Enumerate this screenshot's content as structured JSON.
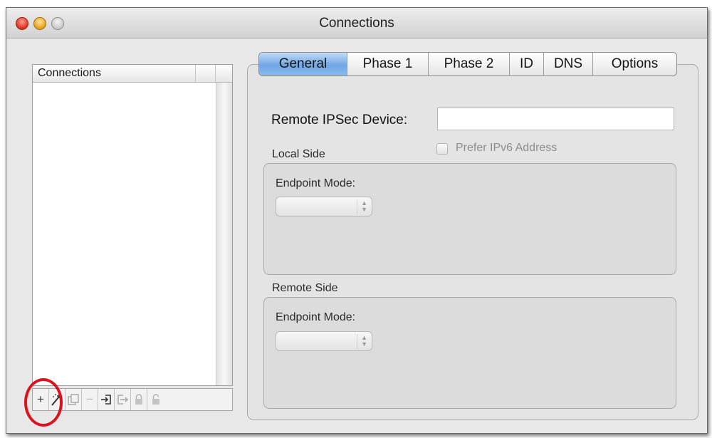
{
  "window": {
    "title": "Connections"
  },
  "connections_list": {
    "column_header": "Connections"
  },
  "toolbar": {
    "add": "+",
    "remove": "−"
  },
  "tabs": [
    {
      "label": "General",
      "active": true
    },
    {
      "label": "Phase 1",
      "active": false
    },
    {
      "label": "Phase 2",
      "active": false
    },
    {
      "label": "ID",
      "active": false
    },
    {
      "label": "DNS",
      "active": false
    },
    {
      "label": "Options",
      "active": false
    }
  ],
  "general": {
    "remote_device_label": "Remote IPSec Device:",
    "remote_device_value": "",
    "prefer_ipv6_label": "Prefer IPv6 Address",
    "prefer_ipv6_checked": false,
    "local_side": {
      "title": "Local Side",
      "endpoint_mode_label": "Endpoint Mode:",
      "endpoint_mode_value": ""
    },
    "remote_side": {
      "title": "Remote Side",
      "endpoint_mode_label": "Endpoint Mode:",
      "endpoint_mode_value": ""
    }
  },
  "colors": {
    "active_tab": "#6fa6e4",
    "highlight_ring": "#d9141c"
  },
  "icons": [
    "add-icon",
    "magic-wand-icon",
    "duplicate-icon",
    "remove-icon",
    "import-icon",
    "export-icon",
    "lock-icon",
    "unlock-icon"
  ]
}
